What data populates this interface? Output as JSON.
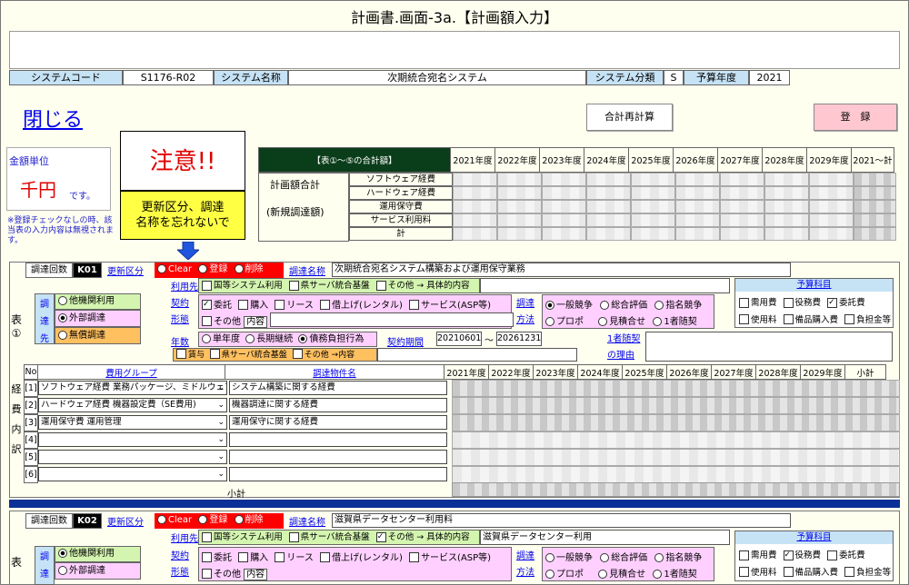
{
  "title": "計画書.画面-3a.【計画額入力】",
  "system": {
    "code_label": "システムコード",
    "code": "S1176-R02",
    "name_label": "システム名称",
    "name": "次期統合宛名システム",
    "cat_label": "システム分類",
    "cat": "S",
    "year_label": "予算年度",
    "year": "2021"
  },
  "close_label": "閉じる",
  "recalc_label": "合計再計算",
  "register_label": "登　録",
  "unit": {
    "label": "金額単位",
    "value": "千円",
    "suffix": "です。"
  },
  "note": "※登録チェックなしの時、該当表の入力内容は無視されます。",
  "warn": {
    "title": "注意!!",
    "body1": "更新区分、調達",
    "body2": "名称を忘れないで"
  },
  "summary": {
    "header": "【表①～⑤の合計額】",
    "left1": "計画額合計",
    "left2": "(新規調達額)",
    "rows": [
      "ソフトウェア経費",
      "ハードウェア経費",
      "運用保守費",
      "サービス利用料",
      "計"
    ]
  },
  "years": [
    "2021年度",
    "2022年度",
    "2023年度",
    "2024年度",
    "2025年度",
    "2026年度",
    "2027年度",
    "2028年度",
    "2029年度",
    "2021～計"
  ],
  "years_b": [
    "2021年度",
    "2022年度",
    "2023年度",
    "2024年度",
    "2025年度",
    "2026年度",
    "2027年度",
    "2028年度",
    "2029年度",
    "小計"
  ],
  "t1": {
    "count_label": "調達回数",
    "code": "K01",
    "kubun_label": "更新区分",
    "clear": "Clear",
    "reg": "登録",
    "del": "削除",
    "name_label": "調達名称",
    "name": "次期統合宛名システム構築および運用保守業務",
    "side": "表①",
    "cho_label": [
      "調",
      "達",
      "先"
    ],
    "cho": [
      "他機関利用",
      "外部調達",
      "無償調達"
    ],
    "riyo_label": "利用先",
    "riyo": [
      "国等システム利用",
      "県サーバ統合基盤",
      "その他 → 具体的内容"
    ],
    "keiyaku_label": [
      "契約",
      "形態"
    ],
    "keiyaku": [
      "委託",
      "購入",
      "リース",
      "借上げ(レンタル)",
      "サービス(ASP等)",
      "その他"
    ],
    "naiyo": "内容",
    "hoho_label": [
      "調達",
      "方法"
    ],
    "hoho": [
      "一般競争",
      "総合評価",
      "指名競争",
      "プロポ",
      "見積合せ",
      "1者随契"
    ],
    "nensu_label": "年数",
    "nensu": [
      "単年度",
      "長期継続",
      "債務負担行為"
    ],
    "kikan_label": "契約期間",
    "kikan_from": "20210601",
    "kikan_to": "20261231",
    "tilde": "～",
    "sub": [
      "賃与",
      "県サーバ統合基盤",
      "その他 →内容"
    ],
    "ichi_label": [
      "1者随契",
      "の理由"
    ],
    "yosan_label": "予算科目",
    "yosan": [
      "需用費",
      "役務費",
      "委託費",
      "使用料",
      "備品購入費",
      "負担金等"
    ],
    "no": "No",
    "group_label": "費用グループ",
    "bukken_label": "調達物件名",
    "side2": [
      "経",
      "費",
      "内",
      "訳"
    ],
    "rows": [
      {
        "no": "[1]",
        "group": "ソフトウェア経費 業務パッケージ、ミドルウェア",
        "name": "システム構築に関する経費"
      },
      {
        "no": "[2]",
        "group": "ハードウェア経費 機器設定費（SE費用)",
        "name": "機器調達に関する経費"
      },
      {
        "no": "[3]",
        "group": "運用保守費 運用管理",
        "name": "運用保守に関する経費"
      },
      {
        "no": "[4]",
        "group": "",
        "name": ""
      },
      {
        "no": "[5]",
        "group": "",
        "name": ""
      },
      {
        "no": "[6]",
        "group": "",
        "name": ""
      }
    ],
    "subtotal": "小計"
  },
  "t2": {
    "count_label": "調達回数",
    "code": "K02",
    "kubun_label": "更新区分",
    "clear": "Clear",
    "reg": "登録",
    "del": "削除",
    "name_label": "調達名称",
    "name": "滋賀県データセンター利用料",
    "riyo_detail": "滋賀県データセンター利用",
    "side": "表",
    "cho_label": [
      "調",
      "達"
    ],
    "cho": [
      "他機関利用",
      "外部調達"
    ]
  }
}
